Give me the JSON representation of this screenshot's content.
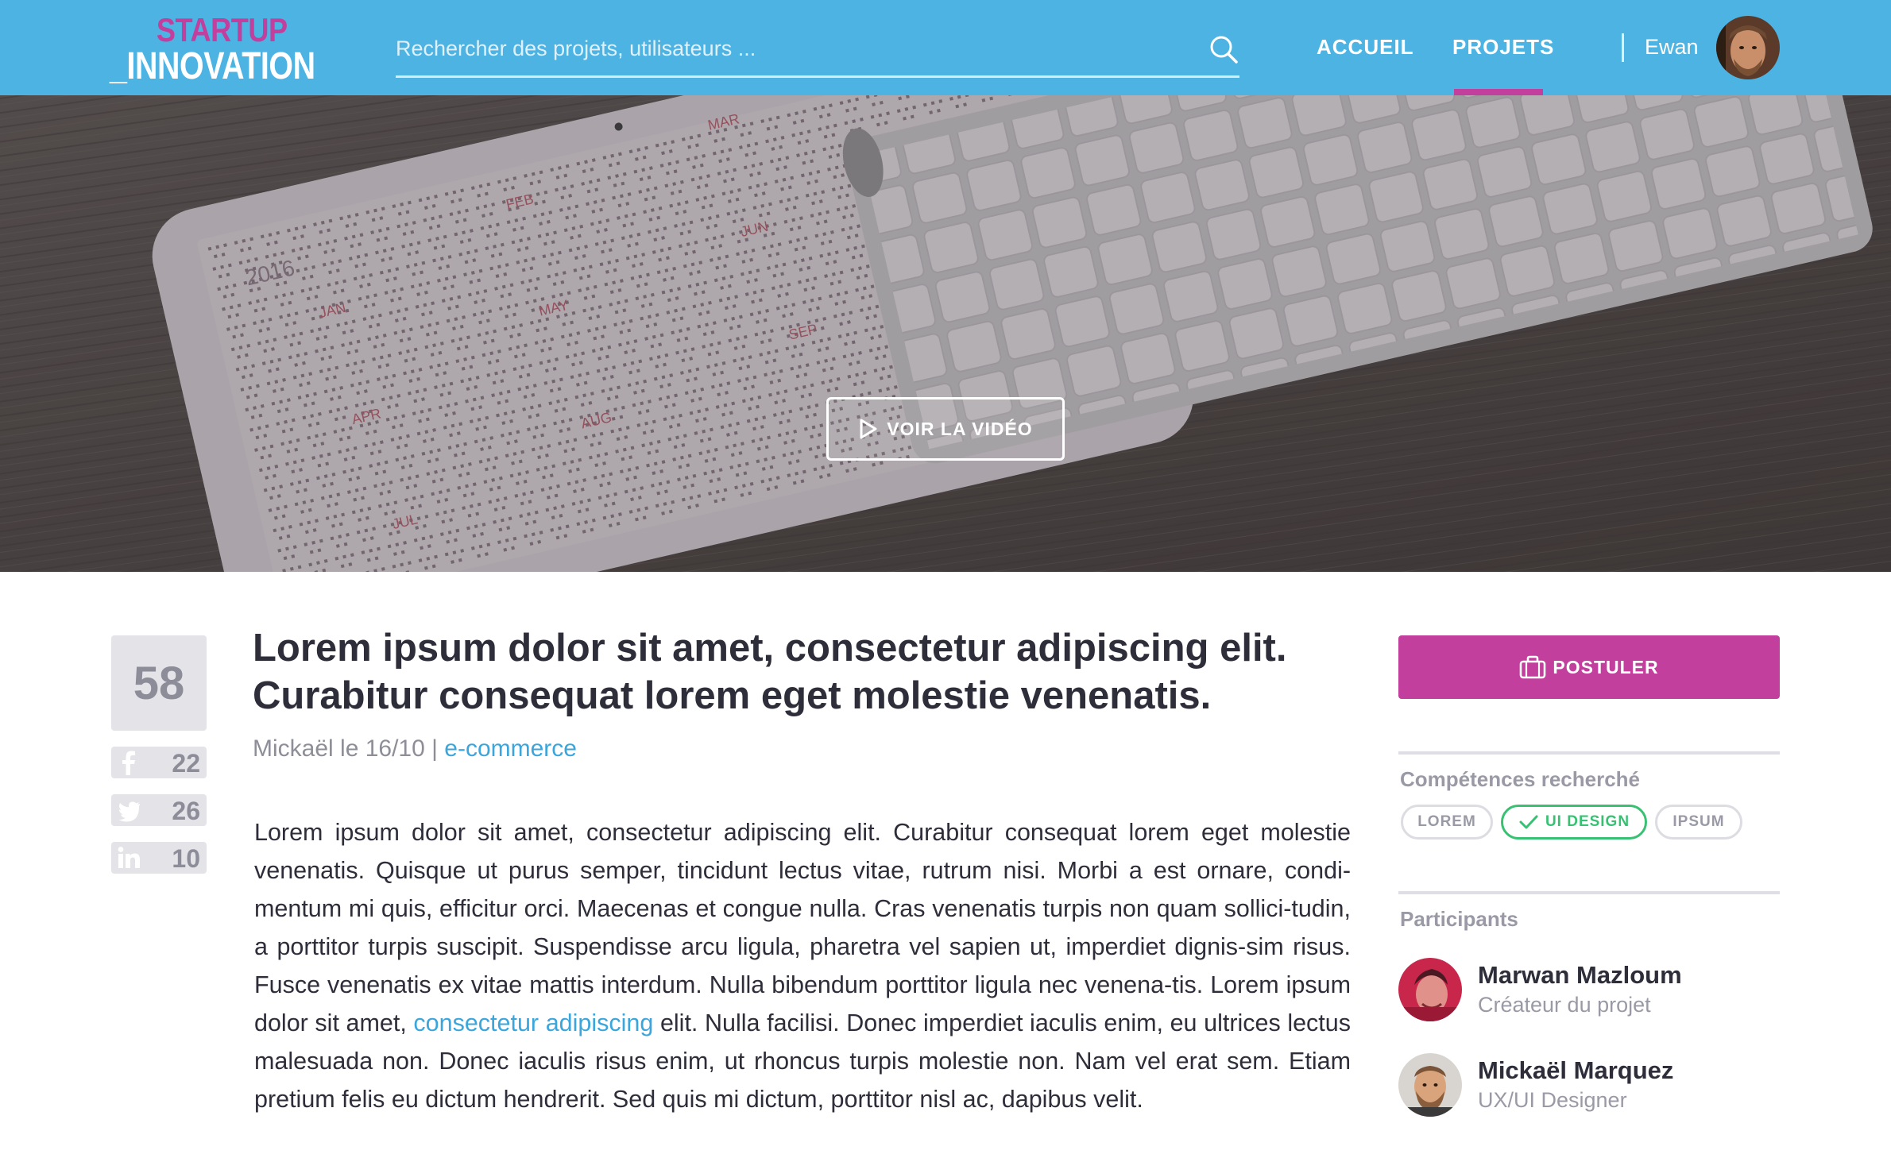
{
  "header": {
    "logo_line1": "STARTUP",
    "logo_line2": "_INNOVATION",
    "search_placeholder": "Rechercher des projets, utilisateurs ...",
    "nav": [
      {
        "label": "ACCUEIL"
      },
      {
        "label": "PROJETS",
        "active": true
      }
    ],
    "user_name": "Ewan"
  },
  "hero": {
    "video_button_label": "VOIR LA VIDÉO"
  },
  "stats": {
    "votes": "58",
    "facebook_shares": "22",
    "twitter_shares": "26",
    "linkedin_shares": "10"
  },
  "article": {
    "title_line1": "Lorem ipsum dolor sit amet, consectetur adipiscing elit.",
    "title_line2": "Curabitur consequat lorem eget molestie venenatis.",
    "author_date": "Mickaël le 16/10",
    "separator": "|",
    "category": "e-commerce",
    "body_part1": "Lorem ipsum dolor sit amet, consectetur adipiscing elit. Curabitur consequat lorem eget molestie venenatis. Quisque ut purus semper, tincidunt lectus vitae, rutrum nisi. Morbi a est ornare, condi-mentum mi quis, efficitur orci. Maecenas et congue nulla. Cras venenatis turpis non quam sollici-tudin, a porttitor turpis suscipit. Suspendisse arcu ligula, pharetra vel sapien ut, imperdiet dignis-sim risus. Fusce venenatis ex vitae mattis interdum. Nulla bibendum porttitor ligula nec venena-tis. Lorem ipsum dolor sit amet, ",
    "body_link": "consectetur adipiscing",
    "body_part2": " elit. Nulla facilisi. Donec imperdiet iaculis enim, eu ultrices lectus malesuada non. Donec iaculis risus enim, ut rhoncus turpis molestie non. Nam vel erat sem. Etiam pretium felis eu dictum hendrerit. Sed quis mi dictum, porttitor nisl ac, dapibus velit."
  },
  "sidebar": {
    "apply_label": "POSTULER",
    "skills_title": "Compétences recherché",
    "skills": [
      "LOREM",
      "UI DESIGN",
      "IPSUM"
    ],
    "selected_skill": "UI DESIGN",
    "participants_title": "Participants",
    "participants": [
      {
        "name": "Marwan Mazloum",
        "role": "Créateur du projet"
      },
      {
        "name": "Mickaël Marquez",
        "role": "UX/UI Designer"
      }
    ]
  },
  "colors": {
    "header_bg": "#4cb3e3",
    "accent_magenta": "#c23f9d",
    "link_blue": "#3aa6dc",
    "skill_selected_green": "#38c172"
  }
}
